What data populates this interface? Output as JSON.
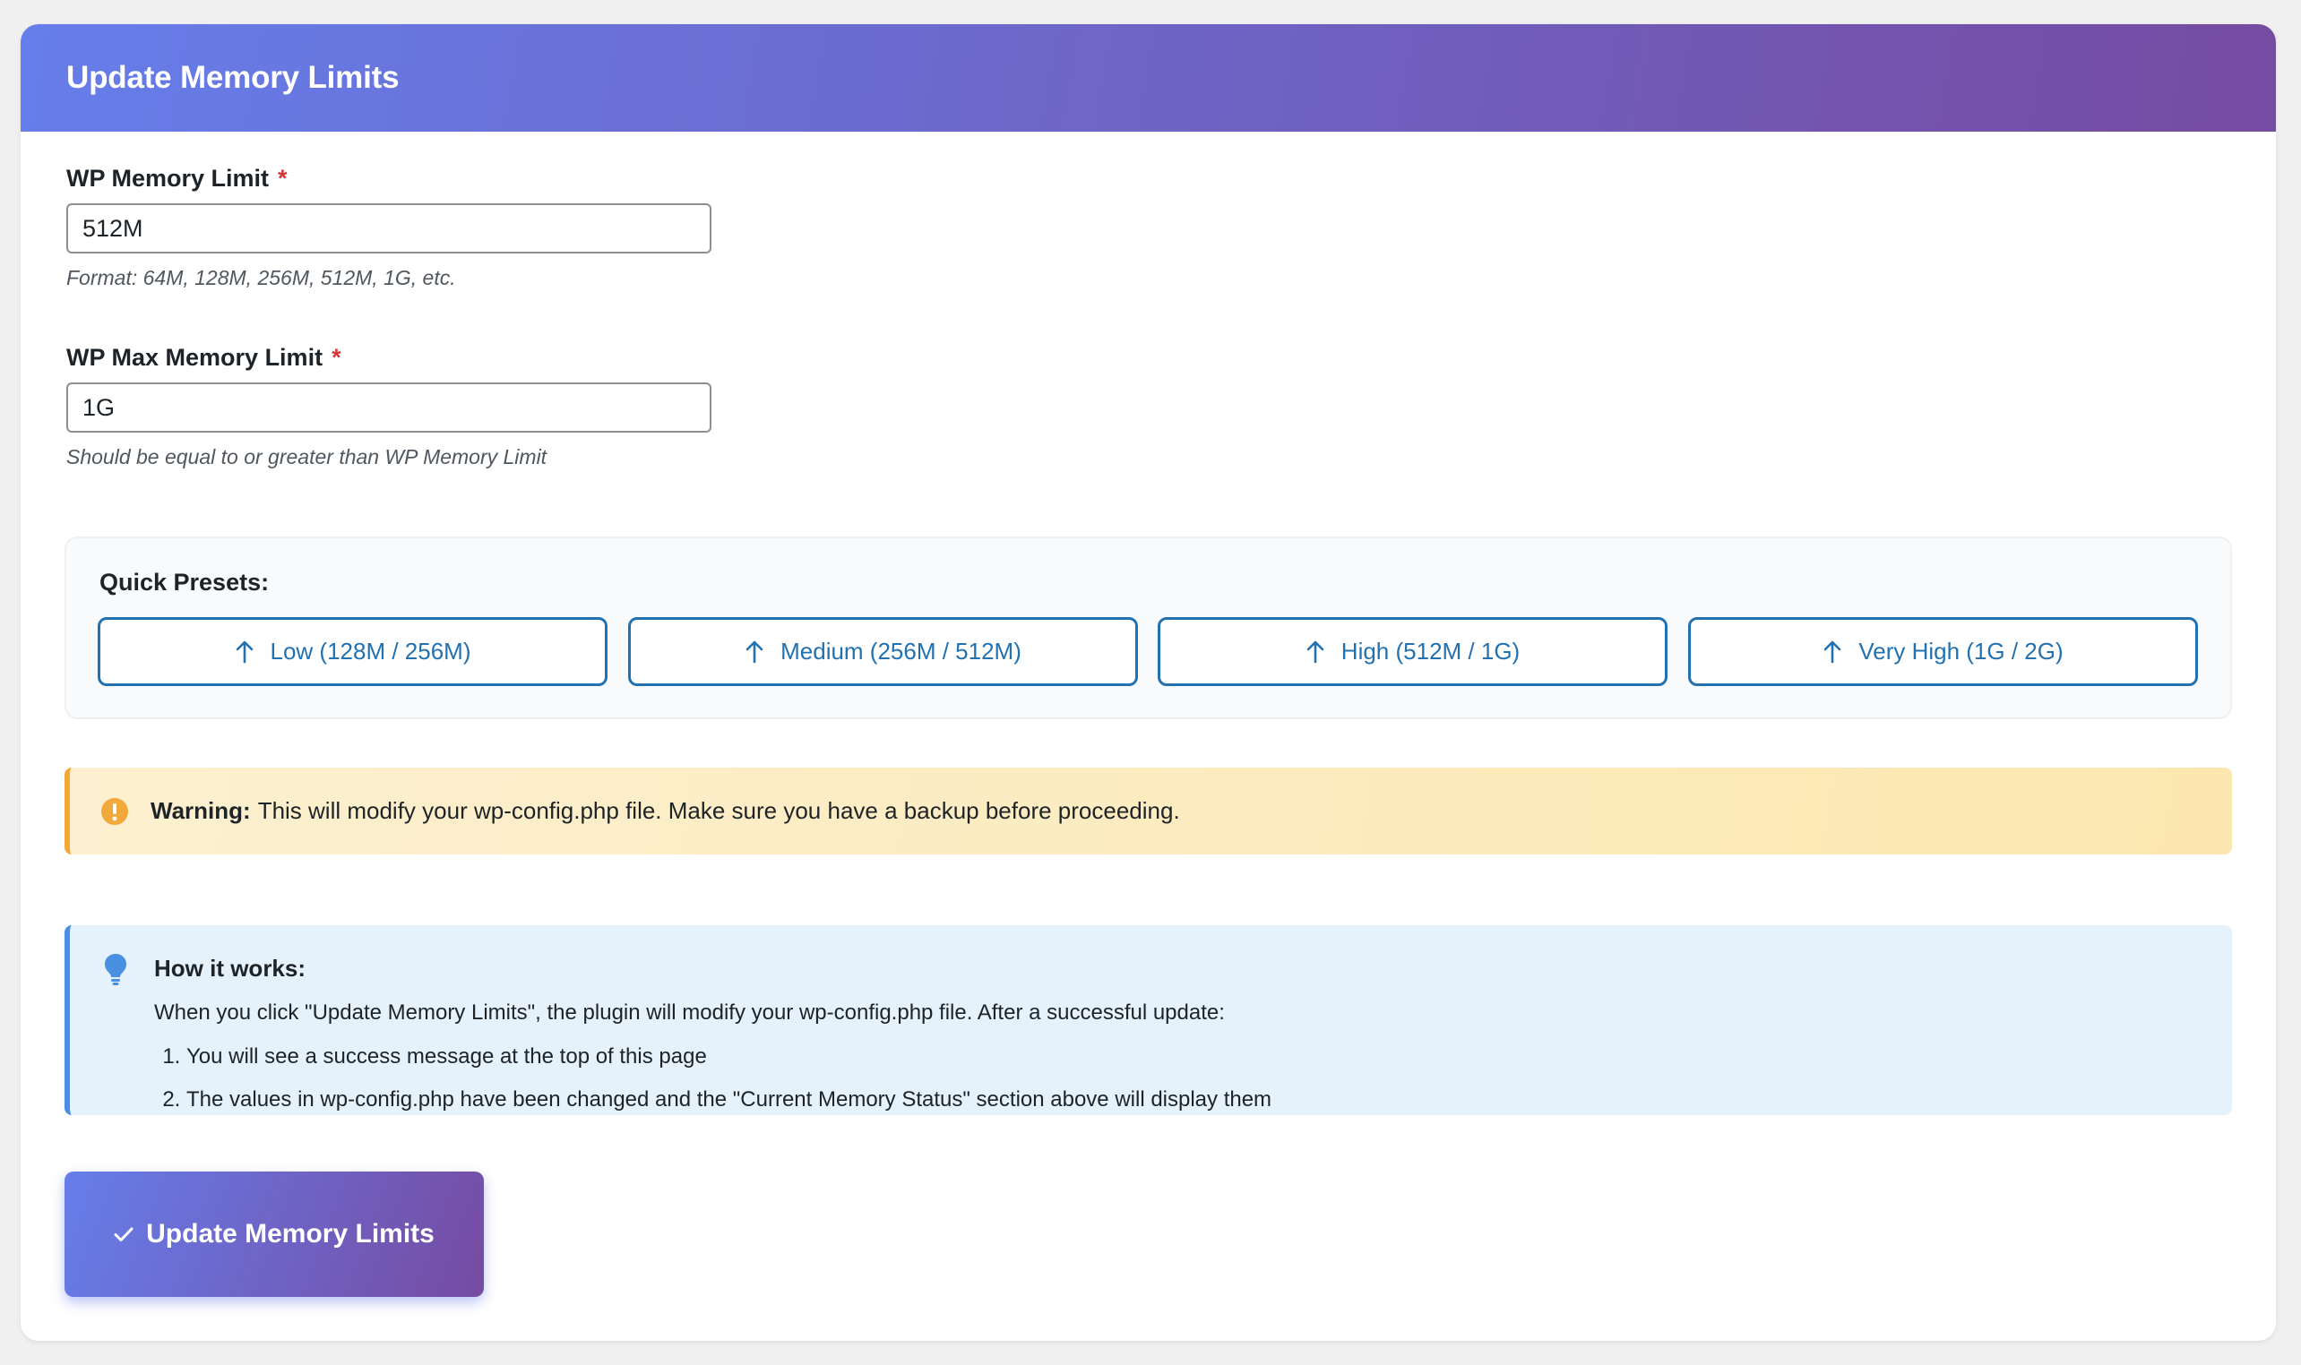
{
  "header": {
    "title": "Update Memory Limits"
  },
  "form": {
    "wp_memory_limit": {
      "label": "WP Memory Limit",
      "required_mark": "*",
      "value": "512M",
      "hint": "Format: 64M, 128M, 256M, 512M, 1G, etc."
    },
    "wp_max_memory_limit": {
      "label": "WP Max Memory Limit",
      "required_mark": "*",
      "value": "1G",
      "hint": "Should be equal to or greater than WP Memory Limit"
    }
  },
  "presets": {
    "title": "Quick Presets:",
    "items": [
      {
        "label": "Low (128M / 256M)",
        "icon": "arrow-up-icon"
      },
      {
        "label": "Medium (256M / 512M)",
        "icon": "arrow-up-icon"
      },
      {
        "label": "High (512M / 1G)",
        "icon": "arrow-up-icon"
      },
      {
        "label": "Very High (1G / 2G)",
        "icon": "arrow-up-icon"
      }
    ]
  },
  "warning": {
    "icon": "warning-icon",
    "label": "Warning:",
    "text": "This will modify your wp-config.php file. Make sure you have a backup before proceeding."
  },
  "info": {
    "icon": "lightbulb-icon",
    "title": "How it works:",
    "text": "When you click \"Update Memory Limits\", the plugin will modify your wp-config.php file. After a successful update:",
    "steps": [
      "You will see a success message at the top of this page",
      "The values in wp-config.php have been changed and the \"Current Memory Status\" section above will display them"
    ]
  },
  "submit": {
    "icon": "checkmark-icon",
    "label": "Update Memory Limits"
  },
  "colors": {
    "gradient_start": "#667eea",
    "gradient_end": "#764ba2",
    "preset_blue": "#2271b1",
    "required_red": "#d63638",
    "warning_orange": "#f0a93a",
    "info_blue": "#4a90e2"
  }
}
